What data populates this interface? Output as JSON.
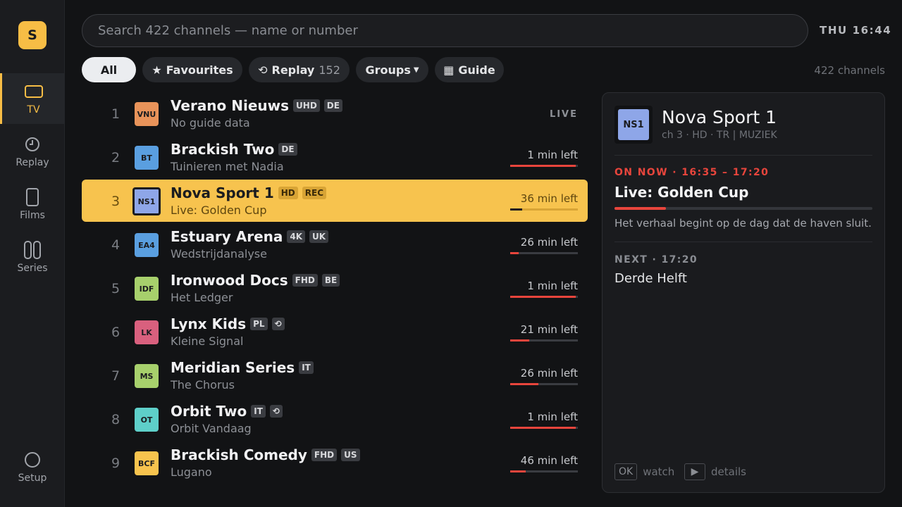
{
  "app": {
    "logo_letter": "S",
    "clock": "THU 16:44"
  },
  "sidebar": {
    "items": [
      {
        "label": "TV",
        "icon": "tv-icon",
        "active": true
      },
      {
        "label": "Replay",
        "icon": "clock-icon",
        "active": false
      },
      {
        "label": "Films",
        "icon": "film-icon",
        "active": false
      },
      {
        "label": "Series",
        "icon": "series-icon",
        "active": false
      },
      {
        "label": "Setup",
        "icon": "settings-icon",
        "active": false
      }
    ]
  },
  "search": {
    "placeholder": "Search 422 channels — name or number"
  },
  "filters": {
    "all": "All",
    "favourites": "Favourites",
    "replay": "Replay",
    "replay_count": "152",
    "groups": "Groups",
    "guide": "Guide"
  },
  "channel_count": "422 channels",
  "channels": [
    {
      "num": "1",
      "logo": "VNU",
      "logo_color": "#e8935a",
      "name": "Verano Nieuws",
      "badges": [
        "UHD",
        "DE"
      ],
      "program": "No guide data",
      "status": "LIVE",
      "progress": null
    },
    {
      "num": "2",
      "logo": "BT",
      "logo_color": "#5a9fe0",
      "name": "Brackish Two",
      "badges": [
        "DE"
      ],
      "program": "Tuinieren met Nadia",
      "status": "1 min left",
      "progress": 0.97
    },
    {
      "num": "3",
      "logo": "NS1",
      "logo_color": "#8ea6e8",
      "name": "Nova Sport 1",
      "badges": [
        "HD",
        "REC"
      ],
      "program": "Live: Golden Cup",
      "status": "36 min left",
      "progress": 0.18,
      "selected": true
    },
    {
      "num": "4",
      "logo": "EA4",
      "logo_color": "#5a9fe0",
      "name": "Estuary Arena",
      "badges": [
        "4K",
        "UK"
      ],
      "program": "Wedstrijdanalyse",
      "status": "26 min left",
      "progress": 0.12
    },
    {
      "num": "5",
      "logo": "IDF",
      "logo_color": "#a7d06c",
      "name": "Ironwood Docs",
      "badges": [
        "FHD",
        "BE"
      ],
      "program": "Het Ledger",
      "status": "1 min left",
      "progress": 0.97
    },
    {
      "num": "6",
      "logo": "LK",
      "logo_color": "#d9607e",
      "name": "Lynx Kids",
      "badges": [
        "PL",
        "⟲"
      ],
      "program": "Kleine Signal",
      "status": "21 min left",
      "progress": 0.28
    },
    {
      "num": "7",
      "logo": "MS",
      "logo_color": "#a7d06c",
      "name": "Meridian Series",
      "badges": [
        "IT"
      ],
      "program": "The Chorus",
      "status": "26 min left",
      "progress": 0.42
    },
    {
      "num": "8",
      "logo": "OT",
      "logo_color": "#5ecfc9",
      "name": "Orbit Two",
      "badges": [
        "IT",
        "⟲"
      ],
      "program": "Orbit Vandaag",
      "status": "1 min left",
      "progress": 0.97
    },
    {
      "num": "9",
      "logo": "BCF",
      "logo_color": "#f7c34e",
      "name": "Brackish Comedy",
      "badges": [
        "FHD",
        "US"
      ],
      "program": "Lugano",
      "status": "46 min left",
      "progress": 0.23
    }
  ],
  "details": {
    "logo": "NS1",
    "name": "Nova Sport 1",
    "meta": "ch 3 · HD · TR | MUZIEK",
    "now_label": "ON NOW · 16:35 – 17:20",
    "now_title": "Live: Golden Cup",
    "now_progress": 0.2,
    "now_desc": "Het verhaal begint op de dag dat de haven sluit.",
    "next_label": "NEXT · 17:20",
    "next_title": "Derde Helft",
    "hint_ok_key": "OK",
    "hint_ok_label": "watch",
    "hint_details_key": "▶",
    "hint_details_label": "details"
  }
}
